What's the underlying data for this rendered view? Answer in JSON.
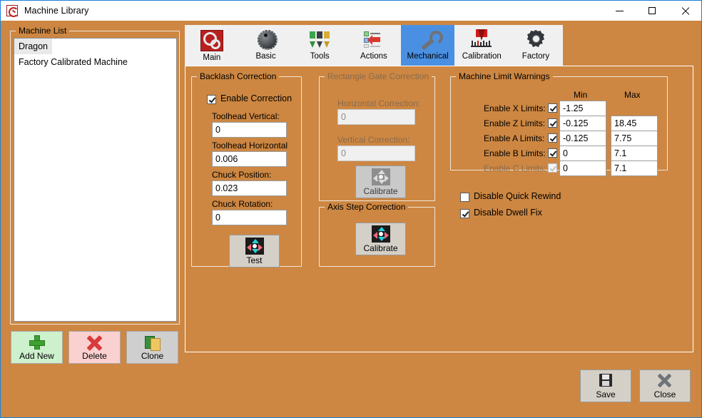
{
  "window": {
    "title": "Machine Library",
    "icon": "app-gear-icon",
    "minimize": "—",
    "maximize": "□",
    "close": "✕",
    "background_color": "#cd8742",
    "accent_color": "#4a90e2"
  },
  "machine_list": {
    "group_title": "Machine List",
    "items": [
      {
        "label": "Dragon",
        "selected": true
      },
      {
        "label": "Factory Calibrated Machine",
        "selected": false
      }
    ]
  },
  "left_buttons": [
    {
      "label": "Add New",
      "icon": "plus-icon",
      "color": "#cdf0cd"
    },
    {
      "label": "Delete",
      "icon": "x-mark-icon",
      "color": "#fbd0d0"
    },
    {
      "label": "Clone",
      "icon": "copy-pages-icon",
      "color": "#cfcfcf"
    }
  ],
  "tabs": [
    {
      "label": "Main",
      "icon": "red-gears-icon",
      "active": false
    },
    {
      "label": "Basic",
      "icon": "knob-dial-icon",
      "active": false
    },
    {
      "label": "Tools",
      "icon": "pen-tips-icon",
      "active": false
    },
    {
      "label": "Actions",
      "icon": "list-arrow-icon",
      "active": false
    },
    {
      "label": "Mechanical",
      "icon": "wrench-icon",
      "active": true
    },
    {
      "label": "Calibration",
      "icon": "ruler-marker-icon",
      "active": false
    },
    {
      "label": "Factory",
      "icon": "gear-icon",
      "active": false
    }
  ],
  "backlash": {
    "group_title": "Backlash Correction",
    "enable_label": "Enable Correction",
    "enable_checked": true,
    "fields": [
      {
        "label": "Toolhead Vertical:",
        "value": "0"
      },
      {
        "label": "Toolhead Horizontal",
        "value": "0.006"
      },
      {
        "label": "Chuck Position:",
        "value": "0.023"
      },
      {
        "label": "Chuck Rotation:",
        "value": "0"
      }
    ],
    "test_button": "Test",
    "test_icon": "dpad-arrows-icon"
  },
  "rect_gate": {
    "group_title": "Rectangle Gate Correction",
    "enabled": false,
    "fields": [
      {
        "label": "Horizontal Correction:",
        "value": "0"
      },
      {
        "label": "Vertical Correction:",
        "value": "0"
      }
    ],
    "calibrate_button": "Calibrate",
    "calibrate_icon": "dpad-arrows-icon-disabled"
  },
  "axis_step": {
    "group_title": "Axis Step Correction",
    "calibrate_button": "Calibrate",
    "calibrate_icon": "dpad-arrows-icon"
  },
  "limits": {
    "group_title": "Machine Limit Warnings",
    "col_min": "Min",
    "col_max": "Max",
    "rows": [
      {
        "label": "Enable X Limits:",
        "checked": true,
        "enabled": true,
        "min": "-1.25",
        "max": "",
        "max_visible": false
      },
      {
        "label": "Enable Z Limits:",
        "checked": true,
        "enabled": true,
        "min": "-0.125",
        "max": "18.45",
        "max_visible": true
      },
      {
        "label": "Enable A Limits:",
        "checked": true,
        "enabled": true,
        "min": "-0.125",
        "max": "7.75",
        "max_visible": true
      },
      {
        "label": "Enable B Limits:",
        "checked": true,
        "enabled": true,
        "min": "0",
        "max": "7.1",
        "max_visible": true
      },
      {
        "label": "Enable C Limits:",
        "checked": true,
        "enabled": false,
        "min": "0",
        "max": "7.1",
        "max_visible": true
      }
    ]
  },
  "options": [
    {
      "label": "Disable Quick Rewind",
      "checked": false
    },
    {
      "label": "Disable Dwell Fix",
      "checked": true
    }
  ],
  "bottom_buttons": [
    {
      "label": "Save",
      "icon": "floppy-disk-icon"
    },
    {
      "label": "Close",
      "icon": "x-mark-gray-icon"
    }
  ]
}
